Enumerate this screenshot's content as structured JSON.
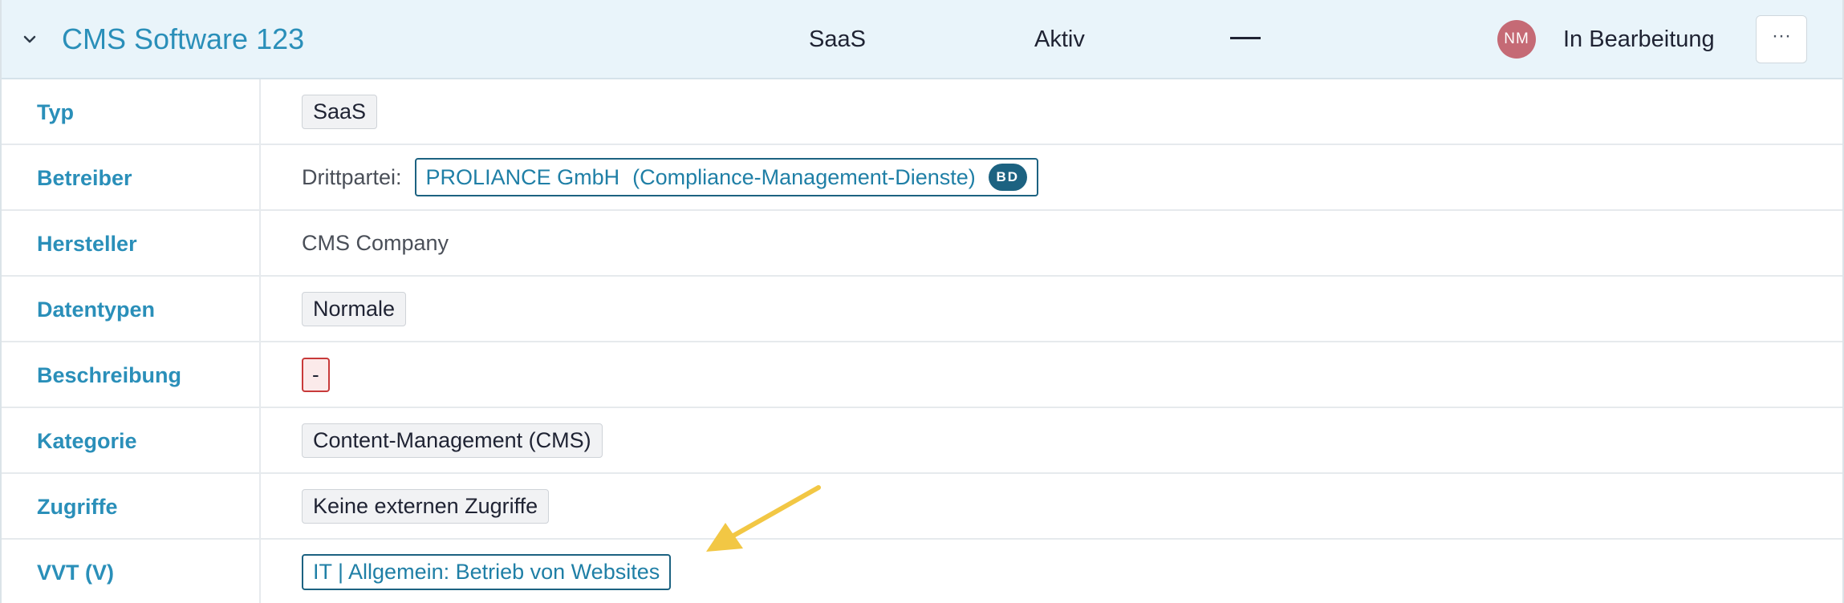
{
  "header": {
    "title": "CMS Software 123",
    "type": "SaaS",
    "status": "Aktiv",
    "dash": "—",
    "avatar_initials": "NM",
    "workflow_status": "In Bearbeitung",
    "more_label": "···"
  },
  "rows": [
    {
      "label": "Typ",
      "value": "SaaS"
    },
    {
      "label": "Betreiber",
      "prefix": "Drittpartei:",
      "operator_name": "PROLIANCE GmbH",
      "operator_service": "(Compliance-Management-Dienste)",
      "badge": "BD"
    },
    {
      "label": "Hersteller",
      "value": "CMS Company"
    },
    {
      "label": "Datentypen",
      "value": "Normale"
    },
    {
      "label": "Beschreibung",
      "value": "-"
    },
    {
      "label": "Kategorie",
      "value": "Content-Management (CMS)"
    },
    {
      "label": "Zugriffe",
      "value": "Keine externen Zugriffe"
    },
    {
      "label": "VVT (V)",
      "value": "IT | Allgemein: Betrieb von Websites"
    }
  ],
  "colors": {
    "accent": "#2a8fb9",
    "header_bg": "#e9f4fa",
    "link_border": "#1c6281",
    "avatar_bg": "#c56a75",
    "empty_border": "#c83a3a",
    "annotation_arrow": "#f2c744"
  },
  "icons": {
    "expand": "chevron-down-icon",
    "more": "more-horizontal-icon"
  }
}
